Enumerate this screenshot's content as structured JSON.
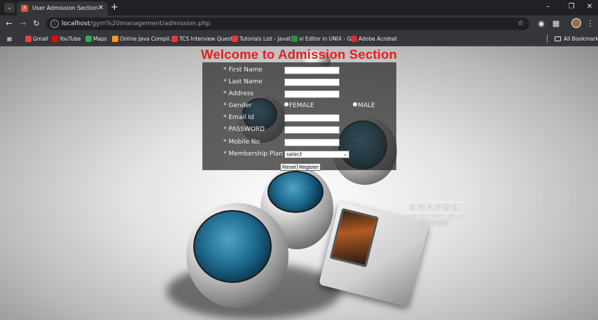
{
  "browser": {
    "tab_title": "User Admission Section",
    "tab_favicon": "XAMPP",
    "url_host": "localhost",
    "url_path": "/gym%20management/admission.php",
    "bookmarks": [
      {
        "label": "Gmail",
        "icon": "gmail-icon",
        "color": "#ea4335"
      },
      {
        "label": "YouTube",
        "icon": "youtube-icon",
        "color": "#ff0000"
      },
      {
        "label": "Maps",
        "icon": "maps-icon",
        "color": "#34a853"
      },
      {
        "label": "Online Java Compil...",
        "icon": "java-icon",
        "color": "#f89820"
      },
      {
        "label": "TCS Interview Quest...",
        "icon": "tcs-icon",
        "color": "#e53935"
      },
      {
        "label": "Tutorials List - Javat...",
        "icon": "javatpoint-icon",
        "color": "#e53935"
      },
      {
        "label": "vi Editor in UNIX - G...",
        "icon": "gfg-icon",
        "color": "#2f8d46"
      },
      {
        "label": "Adobe Acrobat",
        "icon": "acrobat-icon",
        "color": "#d32f2f"
      }
    ],
    "all_bookmarks": "All Bookmarks"
  },
  "page": {
    "heading": "Welcome to Admission Section",
    "fields": {
      "first_name": "* First Name",
      "last_name": "* Last Name",
      "address": "* Address",
      "gender": "* Gender",
      "email": "* Email Id",
      "password": "* PASSWORD",
      "mobile": "* Mobile No",
      "plan": "* Membership Plan"
    },
    "gender_options": {
      "female": "FEMALE",
      "male": "MALE"
    },
    "plan_selected": "select",
    "reset_label": "Reset",
    "register_label": "Register",
    "watermark": {
      "title": "SHAPES",
      "subtitle": "CONTEMPORARY ART OF",
      "signature": "image"
    }
  }
}
